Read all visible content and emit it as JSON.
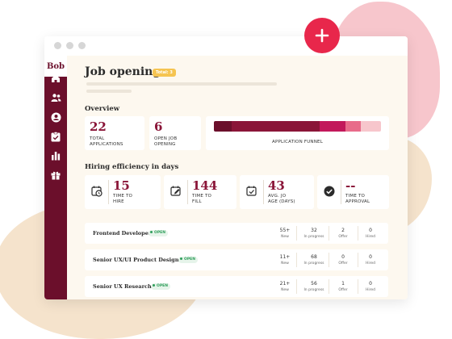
{
  "app": {
    "logo": "Bob"
  },
  "page": {
    "title": "Job opening",
    "badge": "Total: 3"
  },
  "overview": {
    "title": "Overview",
    "total_applications": {
      "value": "22",
      "label_l1": "TOTAL",
      "label_l2": "APPLICATIONS"
    },
    "open_job_opening": {
      "value": "6",
      "label_l1": "OPEN JOB",
      "label_l2": "OPENING"
    },
    "funnel": {
      "label": "APPLICATION FUNNEL",
      "segments": [
        {
          "weight": 12,
          "color": "#6b0f2b"
        },
        {
          "weight": 60,
          "color": "#8a1538"
        },
        {
          "weight": 18,
          "color": "#c2185b"
        },
        {
          "weight": 10,
          "color": "#e86b8a"
        },
        {
          "weight": 14,
          "color": "#f7c6cc"
        }
      ]
    }
  },
  "efficiency": {
    "title": "Hiring efficiency in days",
    "cards": [
      {
        "value": "15",
        "label_l1": "TIME TO",
        "label_l2": "HIRE",
        "icon": "clock-calendar-icon"
      },
      {
        "value": "144",
        "label_l1": "TIME TO",
        "label_l2": "FILL",
        "icon": "edit-calendar-icon"
      },
      {
        "value": "43",
        "label_l1": "AVG. JO",
        "label_l2": "AGE (DAYS)",
        "icon": "check-calendar-icon"
      },
      {
        "value": "--",
        "label_l1": "TIME TO",
        "label_l2": "APPROVAL",
        "icon": "check-circle-icon"
      }
    ]
  },
  "jobs": {
    "headers": [
      "New",
      "In progress",
      "Offer",
      "Hired"
    ],
    "rows": [
      {
        "title": "Frontend Developer",
        "status": "OPEN",
        "new": "55+",
        "in_progress": "32",
        "offer": "2",
        "hired": "0"
      },
      {
        "title": "Senior UX/UI Product Designer",
        "status": "OPEN",
        "new": "11+",
        "in_progress": "68",
        "offer": "0",
        "hired": "0"
      },
      {
        "title": "Senior UX Researcher",
        "status": "OPEN",
        "new": "21+",
        "in_progress": "56",
        "offer": "1",
        "hired": "0"
      }
    ]
  },
  "colors": {
    "brand": "#6b0f2b",
    "accent": "#e8274b",
    "value": "#8a1538",
    "badge": "#f5c451",
    "open": "#2f9e5b"
  },
  "icons": {
    "sidebar": [
      "home-icon",
      "people-icon",
      "person-icon",
      "checklist-icon",
      "chart-icon",
      "gift-icon"
    ],
    "add": "plus-icon"
  }
}
